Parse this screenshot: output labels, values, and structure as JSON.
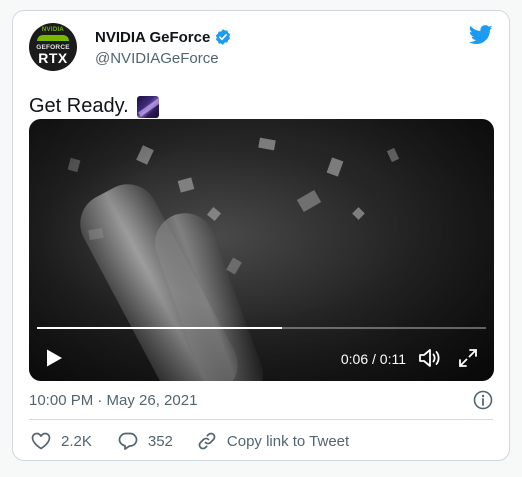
{
  "author": {
    "name": "NVIDIA GeForce",
    "handle": "@NVIDIAGeForce",
    "avatar": {
      "brand": "NVIDIA",
      "line1": "GEFORCE",
      "line2": "RTX"
    }
  },
  "tweet": {
    "text": "Get Ready."
  },
  "video": {
    "time_display": "0:06 / 0:11",
    "progress_fraction": 0.545
  },
  "meta": {
    "timestamp": "10:00 PM · May 26, 2021"
  },
  "actions": {
    "likes": "2.2K",
    "replies": "352",
    "copy_link": "Copy link to Tweet"
  },
  "colors": {
    "twitter_blue": "#1d9bf0",
    "nvidia_green": "#76b900",
    "secondary_text": "#536471"
  },
  "icons": {
    "verified": "verified-badge-icon",
    "logo": "twitter-bird-icon",
    "play": "play-icon",
    "volume": "volume-icon",
    "fullscreen": "fullscreen-icon",
    "info": "info-icon",
    "like": "heart-icon",
    "reply": "reply-bubble-icon",
    "link": "link-icon"
  }
}
